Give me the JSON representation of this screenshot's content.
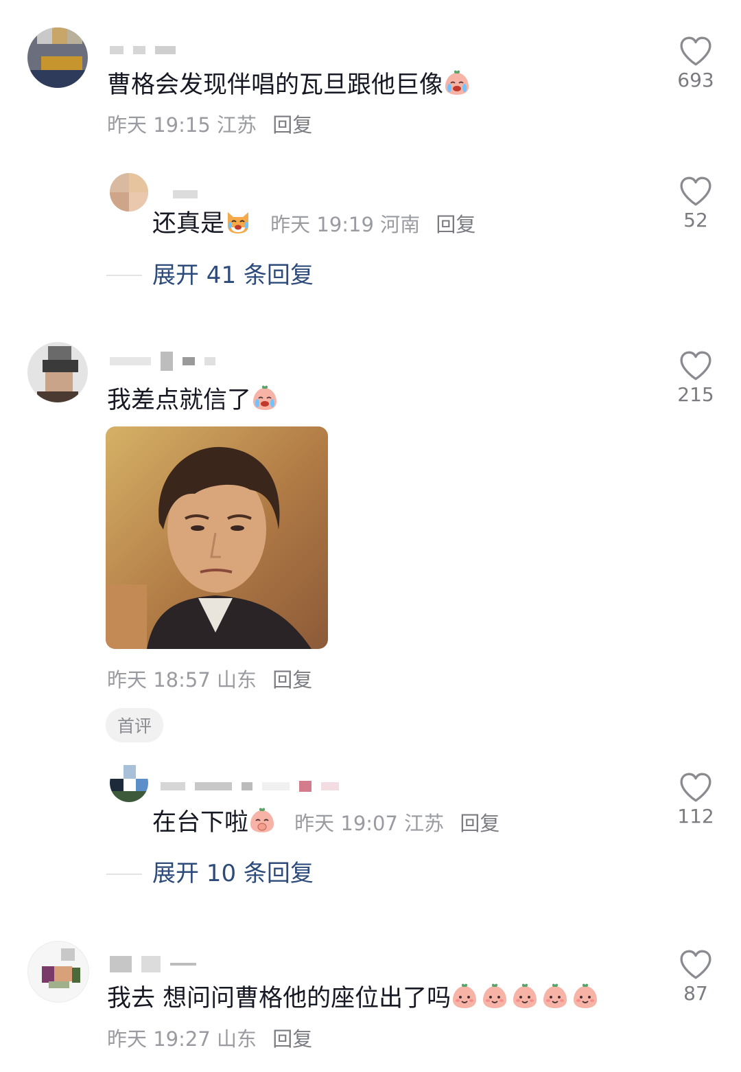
{
  "comments": [
    {
      "text": "曹格会发现伴唱的瓦旦跟他巨像",
      "emoji": "crying-laughing-peach-emoji",
      "time": "昨天 19:15",
      "location": "江苏",
      "reply_label": "回复",
      "likes": "693",
      "sub_reply": {
        "text": "还真是",
        "emoji": "laughing-cat-emoji",
        "time": "昨天 19:19",
        "location": "河南",
        "reply_label": "回复",
        "likes": "52"
      },
      "expand_label": "展开 41 条回复"
    },
    {
      "text": "我差点就信了",
      "emoji": "crying-laughing-peach-emoji",
      "image": "skeptical-man-meme",
      "time": "昨天 18:57",
      "location": "山东",
      "reply_label": "回复",
      "likes": "215",
      "badge": "首评",
      "sub_reply": {
        "text": "在台下啦",
        "emoji": "shy-peach-emoji",
        "time": "昨天 19:07",
        "location": "江苏",
        "reply_label": "回复",
        "likes": "112"
      },
      "expand_label": "展开 10 条回复"
    },
    {
      "text": "我去 想问问曹格他的座位出了吗",
      "emoji": "smiling-peach-emoji",
      "emoji_count": 5,
      "time": "昨天 19:27",
      "location": "山东",
      "reply_label": "回复",
      "likes": "87"
    }
  ],
  "colors": {
    "text": "#161823",
    "meta": "#9a9ba1",
    "expand": "#2c4a7a",
    "like_icon": "#8a8b90"
  }
}
